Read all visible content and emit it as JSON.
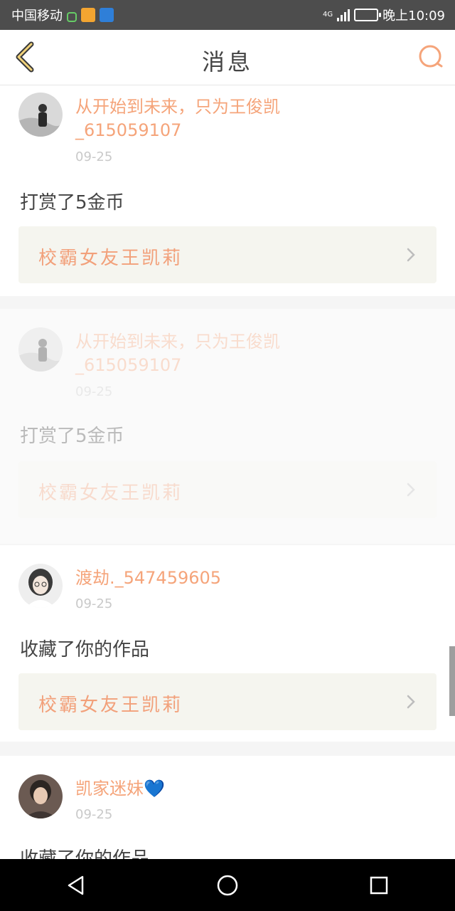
{
  "status_bar": {
    "carrier": "中国移动",
    "network": "4G",
    "time": "晚上10:09",
    "battery_level": 0.3,
    "icons": [
      "lock-icon",
      "app-notification-icon",
      "shield-icon"
    ]
  },
  "header": {
    "title": "消息",
    "back_icon": "chevron-left-icon",
    "search_icon": "search-icon"
  },
  "messages": [
    {
      "user": "从开始到未来，只为王俊凯_615059107",
      "date": "09-25",
      "action": "打赏了5金币",
      "work": "校霸女友王凯莉",
      "faded": false
    },
    {
      "user": "从开始到未来，只为王俊凯_615059107",
      "date": "09-25",
      "action": "打赏了5金币",
      "work": "校霸女友王凯莉",
      "faded": true
    },
    {
      "user": "渡劫._547459605",
      "date": "09-25",
      "action": "收藏了你的作品",
      "work": "校霸女友王凯莉",
      "faded": false
    },
    {
      "user": "凯家迷妹💙",
      "date": "09-25",
      "action": "收藏了你的作品",
      "work": "",
      "faded": false
    }
  ],
  "colors": {
    "accent": "#f5a47a",
    "status_bar": "#4d4d4d",
    "nav_bar": "#000000"
  },
  "nav": {
    "icons": [
      "back-triangle-icon",
      "home-circle-icon",
      "recents-square-icon"
    ]
  }
}
